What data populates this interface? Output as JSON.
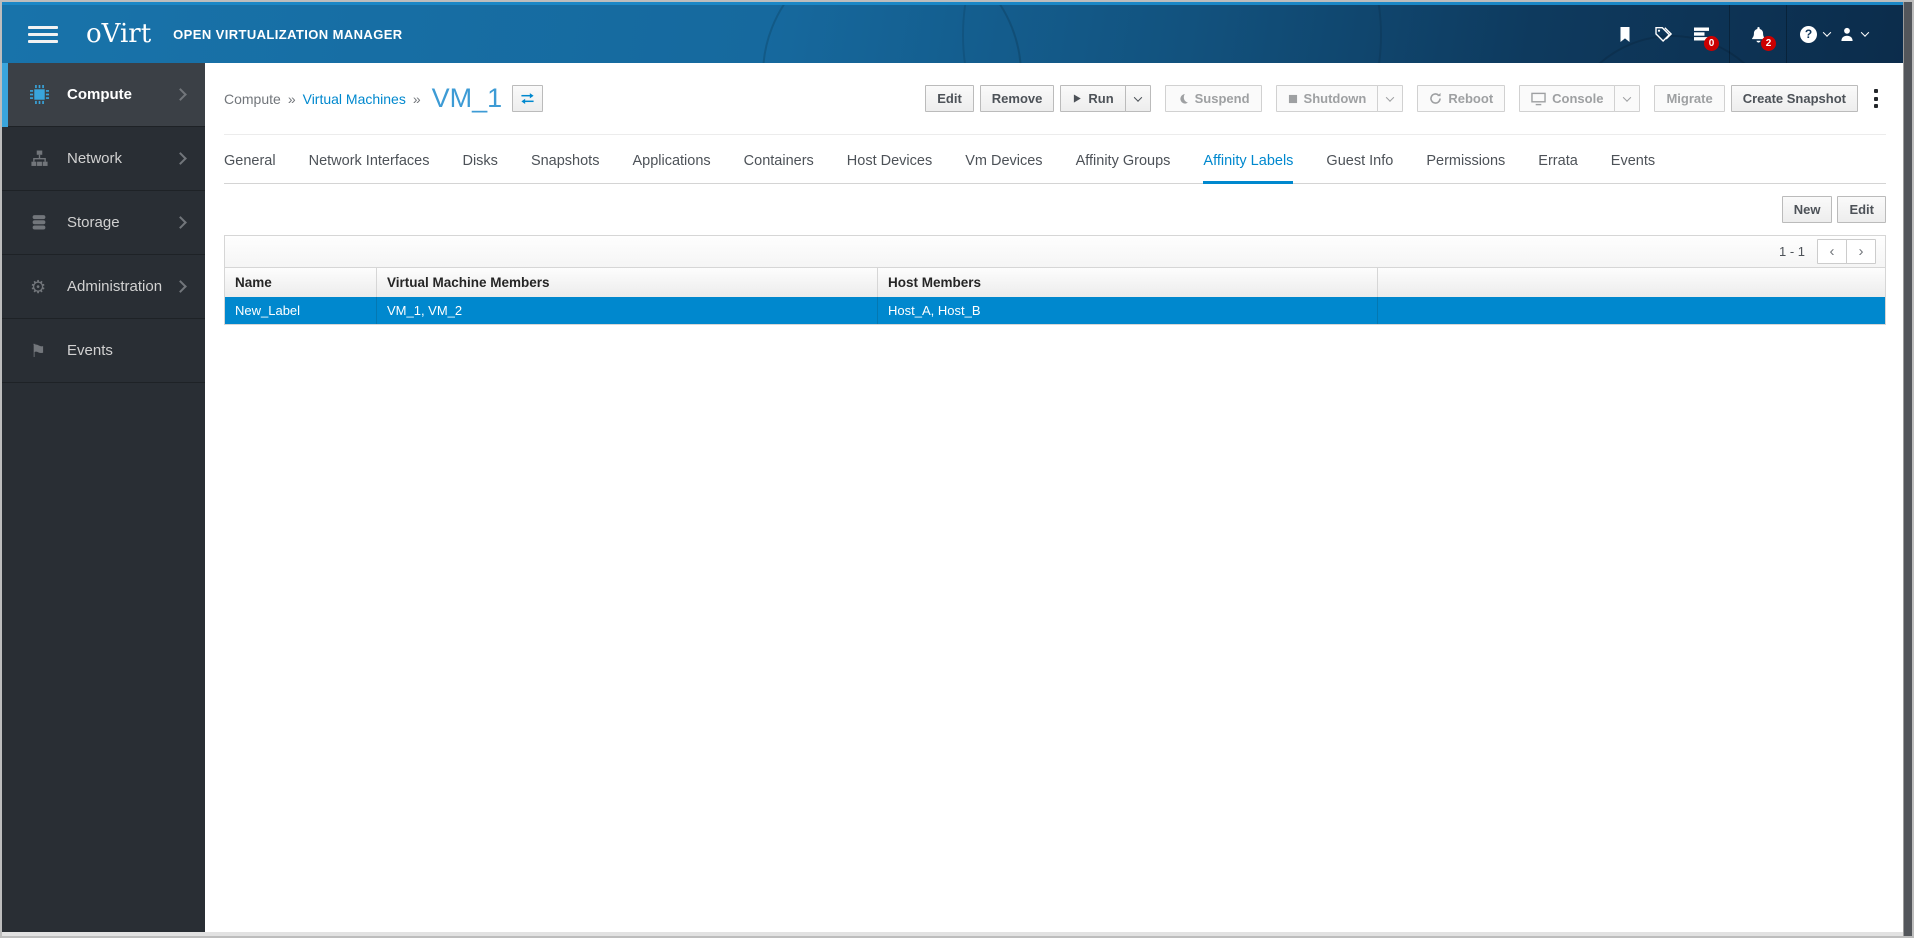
{
  "header": {
    "logo_text": "oVirt",
    "product_name": "OPEN VIRTUALIZATION MANAGER",
    "tasks_badge": "0",
    "alerts_badge": "2",
    "help_glyph": "?"
  },
  "sidebar": {
    "items": [
      {
        "label": "Compute"
      },
      {
        "label": "Network"
      },
      {
        "label": "Storage"
      },
      {
        "label": "Administration"
      },
      {
        "label": "Events"
      }
    ]
  },
  "breadcrumb": {
    "root": "Compute",
    "sep1": "»",
    "parent": "Virtual Machines",
    "sep2": "»",
    "title": "VM_1"
  },
  "actions": {
    "edit": "Edit",
    "remove": "Remove",
    "run": "Run",
    "suspend": "Suspend",
    "shutdown": "Shutdown",
    "reboot": "Reboot",
    "console": "Console",
    "migrate": "Migrate",
    "create_snapshot": "Create Snapshot"
  },
  "tabs": [
    {
      "label": "General"
    },
    {
      "label": "Network Interfaces"
    },
    {
      "label": "Disks"
    },
    {
      "label": "Snapshots"
    },
    {
      "label": "Applications"
    },
    {
      "label": "Containers"
    },
    {
      "label": "Host Devices"
    },
    {
      "label": "Vm Devices"
    },
    {
      "label": "Affinity Groups"
    },
    {
      "label": "Affinity Labels",
      "active": true
    },
    {
      "label": "Guest Info"
    },
    {
      "label": "Permissions"
    },
    {
      "label": "Errata"
    },
    {
      "label": "Events"
    }
  ],
  "panel": {
    "new_button": "New",
    "edit_button": "Edit",
    "pagination_range": "1 - 1",
    "prev_glyph": "‹",
    "next_glyph": "›"
  },
  "table": {
    "columns": [
      "Name",
      "Virtual Machine Members",
      "Host Members"
    ],
    "rows": [
      {
        "name": "New_Label",
        "vm_members": "VM_1, VM_2",
        "host_members": "Host_A, Host_B"
      }
    ]
  },
  "colors": {
    "accent": "#0088ce",
    "selected_row": "#0088ce",
    "badge_red": "#cc0000",
    "nav_active_indicator": "#39a5dc",
    "masthead_top": "#1b87c6"
  }
}
